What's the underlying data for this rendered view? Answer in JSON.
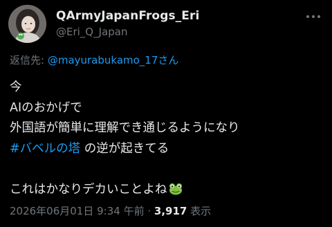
{
  "author": {
    "display_name": "QArmyJapanFrogs_Eri",
    "handle": "@Eri_Q_Japan"
  },
  "reply": {
    "prefix": "返信先: ",
    "mention": "@mayurabukamo_17さん"
  },
  "body": {
    "line1": "今",
    "line2": "AIのおかげで",
    "line3": "外国語が簡単に理解でき通じるようになり",
    "line4_hashtag": "#バベルの塔",
    "line4_rest": " の逆が起きてる",
    "line6": "これはかなりデカいことよね",
    "emoji": "frog-face-emoji"
  },
  "meta": {
    "timestamp": "2026年06月01日 9:34 午前",
    "separator": " · ",
    "views_count": "3,917",
    "views_label": " 表示"
  },
  "colors": {
    "background": "#000000",
    "text": "#e7e9ea",
    "muted": "#71767b",
    "link": "#1d9bf0"
  }
}
